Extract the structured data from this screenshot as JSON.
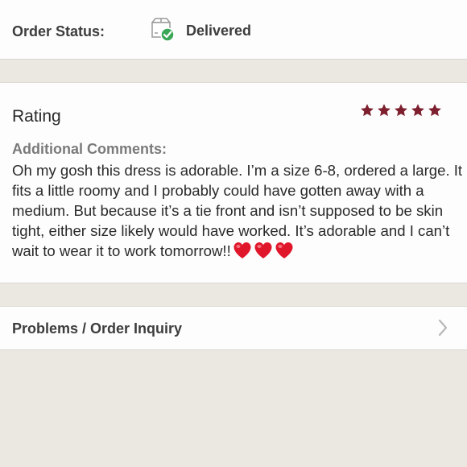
{
  "order_status": {
    "label": "Order Status:",
    "value": "Delivered",
    "icon": "delivered-box-check-icon",
    "check_color": "#3aa757"
  },
  "rating": {
    "heading": "Rating",
    "stars": 5,
    "max_stars": 5,
    "star_color": "#7d1f2e",
    "comments_label": "Additional Comments:",
    "comments_text": "Oh my gosh this dress is adorable. I’m a size 6-8, ordered a large. It fits a little roomy and I probably could have gotten away with a medium. But because it’s a tie front and isn’t supposed to be skin tight, either size likely would have worked. It’s adorable and I can’t wait to wear it to work tomorrow!!",
    "emoji": [
      "red-heart-icon",
      "red-heart-icon",
      "red-heart-icon"
    ]
  },
  "problems": {
    "label": "Problems / Order Inquiry",
    "icon": "chevron-right-icon"
  }
}
